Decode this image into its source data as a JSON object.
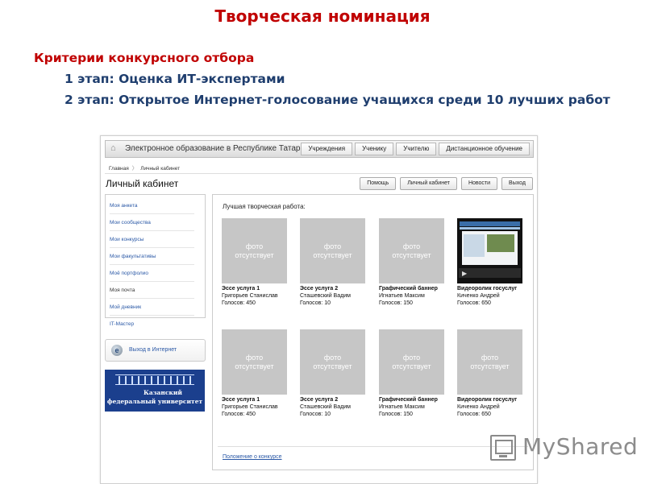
{
  "slide": {
    "title": "Творческая номинация",
    "criteria_heading": "Критерии конкурсного отбора",
    "stage1": "1 этап: Оценка ИТ-экспертами",
    "stage2": "2 этап: Открытое Интернет-голосование учащихся среди 10 лучших работ"
  },
  "portal": {
    "name": "Электронное образование в Республике Татарстан",
    "tabs": [
      "Учреждения",
      "Ученику",
      "Учителю",
      "Дистанционное обучение"
    ],
    "breadcrumbs": [
      "Главная",
      "Личный кабинет"
    ],
    "page_title": "Личный кабинет",
    "buttons": [
      "Помощь",
      "Личный кабинет",
      "Новости",
      "Выход"
    ]
  },
  "sidebar": {
    "items": [
      {
        "label": "Моя анкета"
      },
      {
        "label": "Мои сообщества"
      },
      {
        "label": "Мои конкурсы"
      },
      {
        "label": "Мои факультативы"
      },
      {
        "label": "Моё портфолио"
      },
      {
        "label": "Моя почта"
      },
      {
        "label": "Мой дневник"
      },
      {
        "label": "IT-Мастер"
      }
    ],
    "internet_button": "Выход в Интернет",
    "university_name_line1": "Казанский",
    "university_name_line2": "федеральный университет"
  },
  "main": {
    "heading": "Лучшая творческая работа:",
    "no_photo_line1": "фото",
    "no_photo_line2": "отсутствует",
    "cards": [
      {
        "title": "Эссе услуга 1",
        "author": "Григорьев Станислав",
        "votes": "Голосов: 450",
        "thumb": "none"
      },
      {
        "title": "Эссе услуга 2",
        "author": "Сташевский Вадим",
        "votes": "Голосов: 10",
        "thumb": "none"
      },
      {
        "title": "Графический баннер",
        "author": "Игнатьев Максим",
        "votes": "Голосов: 150",
        "thumb": "none"
      },
      {
        "title": "Видеоролик госуслуг",
        "author": "Киченко Андрей",
        "votes": "Голосов: 650",
        "thumb": "video"
      },
      {
        "title": "Эссе услуга 1",
        "author": "Григорьев Станислав",
        "votes": "Голосов: 450",
        "thumb": "none"
      },
      {
        "title": "Эссе услуга 2",
        "author": "Сташевский Вадим",
        "votes": "Голосов: 10",
        "thumb": "none"
      },
      {
        "title": "Графический баннер",
        "author": "Игнатьев Максим",
        "votes": "Голосов: 150",
        "thumb": "none"
      },
      {
        "title": "Видеоролик госуслуг",
        "author": "Киченко Андрей",
        "votes": "Голосов: 650",
        "thumb": "none"
      }
    ],
    "rules_link": "Положение о конкурсе"
  },
  "watermark": {
    "text": "MyShared"
  },
  "colors": {
    "slide_title": "#c00000",
    "stage_text": "#1f3e6e",
    "link": "#2a58a6",
    "photo_placeholder": "#c6c6c6",
    "university_banner": "#1b3f8d"
  },
  "icons": {
    "home": "home-icon",
    "internet": "ie-globe-icon",
    "university": "university-building-icon",
    "watermark": "monitor-icon"
  }
}
